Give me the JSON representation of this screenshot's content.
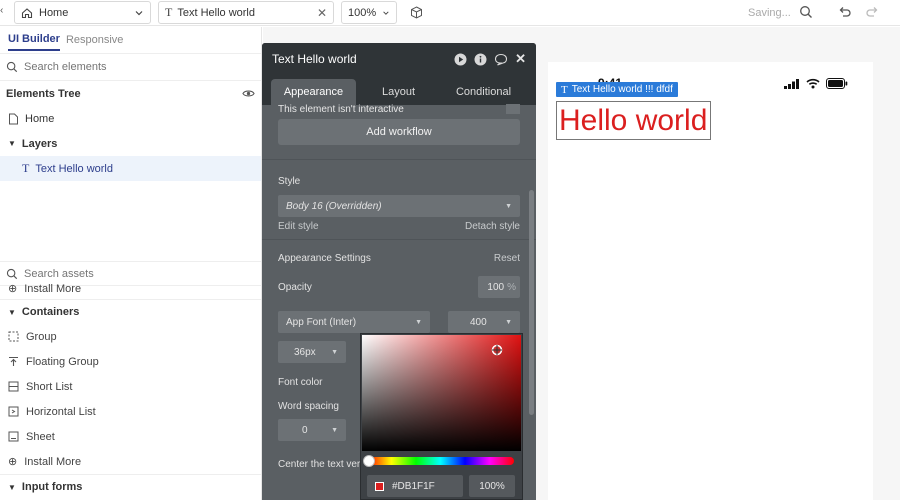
{
  "topbar": {
    "page_select": "Home",
    "element_select": "Text Hello world",
    "zoom": "100%",
    "saving": "Saving..."
  },
  "left": {
    "tabs": [
      "UI Builder",
      "Responsive"
    ],
    "search_elements_placeholder": "Search elements",
    "tree_title": "Elements Tree",
    "tree": {
      "home": "Home",
      "layers": "Layers",
      "selected_item": "Text Hello world"
    },
    "search_assets_placeholder": "Search assets",
    "install_more_1": "Install More",
    "containers": {
      "title": "Containers",
      "items": [
        "Group",
        "Floating Group",
        "Short List",
        "Horizontal List",
        "Sheet"
      ]
    },
    "install_more_2": "Install More",
    "input_forms": "Input forms"
  },
  "prop": {
    "title": "Text Hello world",
    "tabs": [
      "Appearance",
      "Layout",
      "Conditional"
    ],
    "not_interactive": "This element isn't interactive",
    "add_workflow": "Add workflow",
    "style_label": "Style",
    "style_value": "Body 16 (Overridden)",
    "edit_style": "Edit style",
    "detach_style": "Detach style",
    "appearance_settings": "Appearance Settings",
    "reset": "Reset",
    "opacity_label": "Opacity",
    "opacity_value": "100",
    "opacity_unit": "%",
    "font_family": "App Font (Inter)",
    "font_weight": "400",
    "font_size": "36px",
    "font_color": "Font color",
    "word_spacing": "Word spacing",
    "word_spacing_value": "0",
    "center_text": "Center the text ver"
  },
  "picker": {
    "hex": "#DB1F1F",
    "alpha": "100%",
    "swatch_color": "#DB1F1F"
  },
  "canvas": {
    "status_time": "9:41",
    "selection_label": "Text Hello world !!! dfdf",
    "hello_text": "Hello world"
  }
}
